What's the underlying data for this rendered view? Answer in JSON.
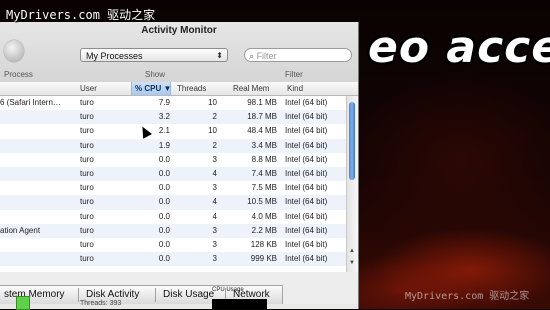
{
  "watermark": {
    "top": "MyDrivers.com 驱动之家",
    "bottom": "MyDrivers.com 驱动之家"
  },
  "background_text": "eo acce",
  "window": {
    "title": "Activity Monitor",
    "process_filter": "My Processes",
    "search_placeholder": "Filter",
    "toolbar_labels": {
      "process": "Process",
      "show": "Show",
      "filter": "Filter"
    }
  },
  "table": {
    "columns": [
      "User",
      "% CPU",
      "Threads",
      "Real Mem",
      "Kind"
    ],
    "sort_indicator": "▼",
    "rows": [
      {
        "name": "6 (Safari Intern…",
        "user": "turo",
        "cpu": "7.9",
        "threads": "10",
        "mem": "98.1 MB",
        "kind": "Intel (64 bit)"
      },
      {
        "name": "",
        "user": "turo",
        "cpu": "3.2",
        "threads": "2",
        "mem": "18.7 MB",
        "kind": "Intel (64 bit)"
      },
      {
        "name": "",
        "user": "turo",
        "cpu": "2.1",
        "threads": "10",
        "mem": "48.4 MB",
        "kind": "Intel (64 bit)"
      },
      {
        "name": "",
        "user": "turo",
        "cpu": "1.9",
        "threads": "2",
        "mem": "3.4 MB",
        "kind": "Intel (64 bit)"
      },
      {
        "name": "",
        "user": "turo",
        "cpu": "0.0",
        "threads": "3",
        "mem": "8.8 MB",
        "kind": "Intel (64 bit)"
      },
      {
        "name": "",
        "user": "turo",
        "cpu": "0.0",
        "threads": "4",
        "mem": "7.4 MB",
        "kind": "Intel (64 bit)"
      },
      {
        "name": "",
        "user": "turo",
        "cpu": "0.0",
        "threads": "3",
        "mem": "7.5 MB",
        "kind": "Intel (64 bit)"
      },
      {
        "name": "",
        "user": "turo",
        "cpu": "0.0",
        "threads": "4",
        "mem": "10.5 MB",
        "kind": "Intel (64 bit)"
      },
      {
        "name": "",
        "user": "turo",
        "cpu": "0.0",
        "threads": "4",
        "mem": "4.0 MB",
        "kind": "Intel (64 bit)"
      },
      {
        "name": "ation Agent",
        "user": "turo",
        "cpu": "0.0",
        "threads": "3",
        "mem": "2.2 MB",
        "kind": "Intel (64 bit)"
      },
      {
        "name": "",
        "user": "turo",
        "cpu": "0.0",
        "threads": "3",
        "mem": "128 KB",
        "kind": "Intel (64 bit)"
      },
      {
        "name": "",
        "user": "turo",
        "cpu": "0.0",
        "threads": "3",
        "mem": "999 KB",
        "kind": "Intel (64 bit)"
      }
    ]
  },
  "tabs": [
    "stem Memory",
    "Disk Activity",
    "Disk Usage",
    "Network"
  ],
  "bottom": {
    "cpu_usage_label": "CPU Usage",
    "threads_label": "Threads:",
    "threads_value": "393"
  }
}
